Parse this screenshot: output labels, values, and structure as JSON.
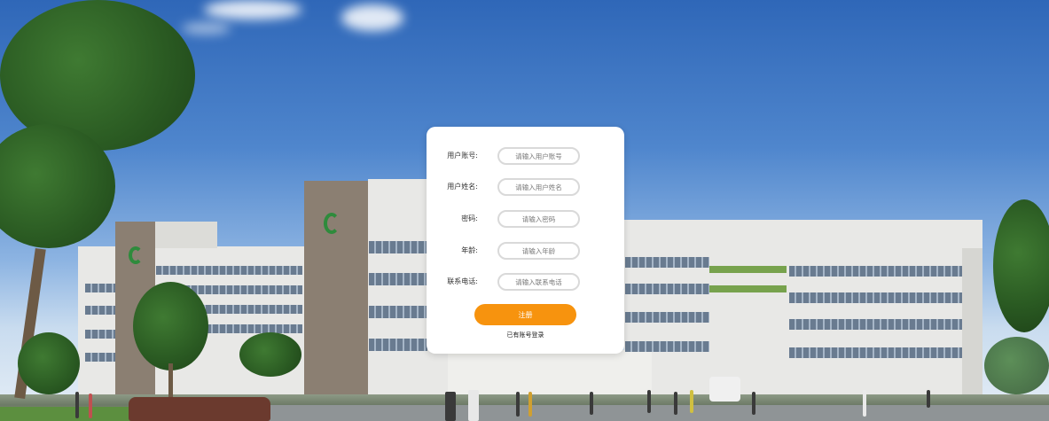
{
  "register_form": {
    "fields": [
      {
        "label": "用户账号:",
        "placeholder": "请输入用户账号"
      },
      {
        "label": "用户姓名:",
        "placeholder": "请输入用户姓名"
      },
      {
        "label": "密码:",
        "placeholder": "请输入密码"
      },
      {
        "label": "年龄:",
        "placeholder": "请输入年龄"
      },
      {
        "label": "联系电话:",
        "placeholder": "请输入联系电话"
      }
    ],
    "submit_label": "注册",
    "login_link": "已有账号登录"
  },
  "colors": {
    "accent": "#f7930e",
    "card_bg": "#ffffff",
    "sky_top": "#2f67b8"
  },
  "background": {
    "description_icon": "hospital-building-background"
  }
}
